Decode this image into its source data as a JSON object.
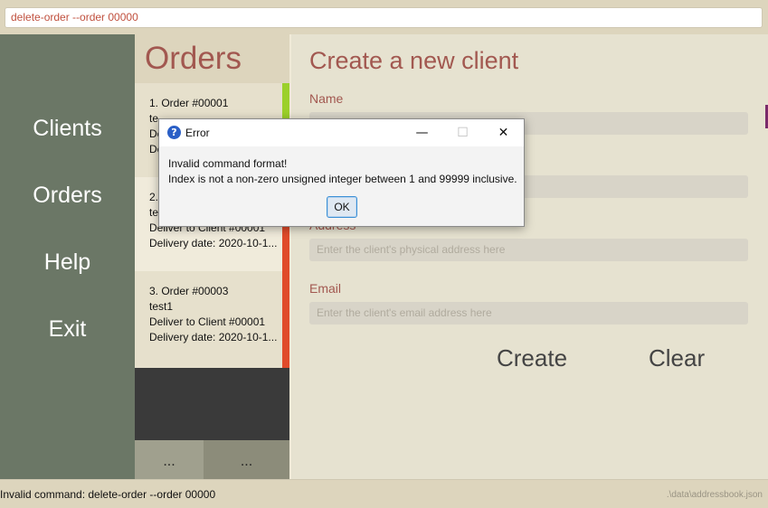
{
  "command_box": {
    "value": "delete-order --order 00000"
  },
  "sidebar": {
    "items": [
      {
        "label": "Clients"
      },
      {
        "label": "Orders"
      },
      {
        "label": "Help"
      },
      {
        "label": "Exit"
      }
    ]
  },
  "orders": {
    "title": "Orders",
    "cards": [
      {
        "line1": "1.  Order #00001",
        "line2": "te",
        "line3": "De",
        "line4": "De",
        "strip_color": "#9bd02a"
      },
      {
        "line1": "2.",
        "line2": "te",
        "line3": "Deliver to Client #00001",
        "line4": "Delivery date: 2020-10-1...",
        "strip_color": "#e04a2a"
      },
      {
        "line1": "3.  Order #00003",
        "line2": "test1",
        "line3": "Deliver to Client #00001",
        "line4": "Delivery date: 2020-10-1...",
        "strip_color": "#e04a2a"
      }
    ],
    "more_left": "...",
    "more_right": "..."
  },
  "form": {
    "title": "Create a new client",
    "name_label": "Name",
    "address_label": "Address",
    "address_placeholder": "Enter the client's physical address here",
    "email_label": "Email",
    "email_placeholder": "Enter the client's email address here",
    "create_label": "Create",
    "clear_label": "Clear"
  },
  "status": {
    "message": "Invalid command: delete-order --order 00000",
    "file_path": ".\\data\\addressbook.json"
  },
  "dialog": {
    "title": "Error",
    "icon": "question-icon",
    "message_line1": "Invalid command format!",
    "message_line2": "Index is not a non-zero unsigned integer between 1 and 99999 inclusive.",
    "ok_label": "OK",
    "minimize_glyph": "—",
    "maximize_glyph": "☐",
    "close_glyph": "✕"
  }
}
